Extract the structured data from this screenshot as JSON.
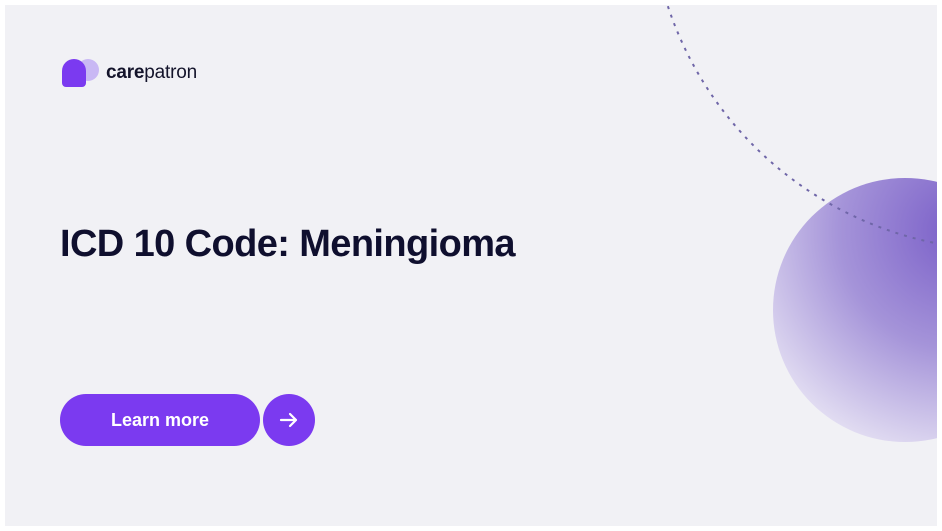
{
  "brand": {
    "name_bold": "care",
    "name_light": "patron",
    "icon": "carepatron-logo-icon",
    "color": "#7b3af0"
  },
  "headline": "ICD 10 Code: Meningioma",
  "cta": {
    "label": "Learn more",
    "icon": "arrow-right-icon"
  },
  "colors": {
    "background": "#f1f1f5",
    "accent": "#7b3af0",
    "text": "#0f0f2e",
    "orb": "#8a72cf"
  }
}
